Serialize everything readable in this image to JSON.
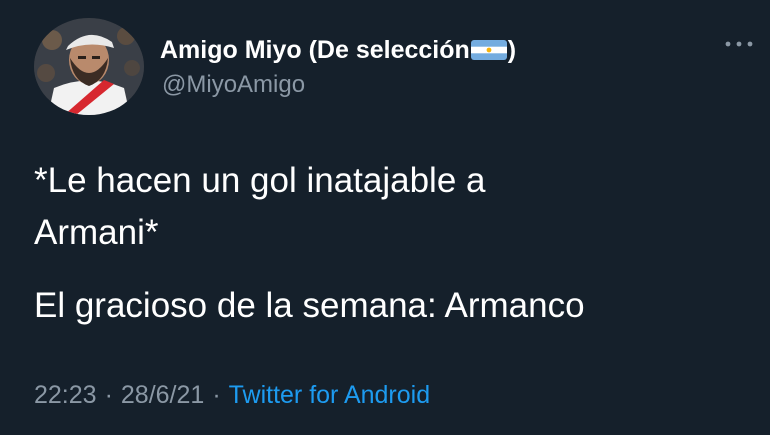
{
  "author": {
    "display_name": "Amigo Miyo (De selección",
    "display_name_suffix": ")",
    "flag_icon": "argentina-flag-icon",
    "handle": "@MiyoAmigo"
  },
  "tweet": {
    "line1": "*Le hacen un gol inatajable a",
    "line2": "Armani*",
    "line3": "El gracioso de la semana: Armanco"
  },
  "meta": {
    "time": "22:23",
    "date": "28/6/21",
    "separator": "·",
    "source": "Twitter for Android"
  },
  "colors": {
    "background": "#15202b",
    "text": "#ffffff",
    "secondary_text": "#8b98a5",
    "link": "#1d9bf0"
  }
}
